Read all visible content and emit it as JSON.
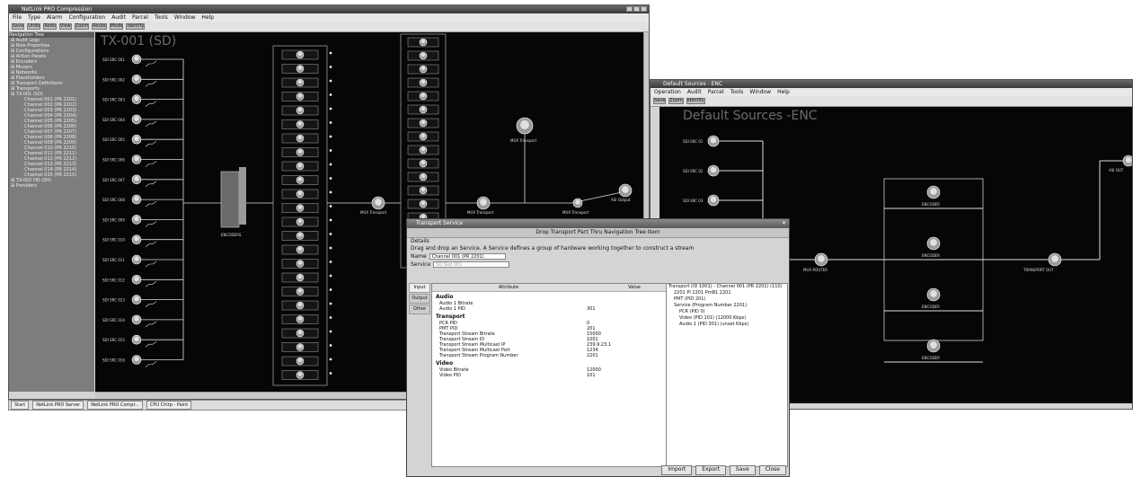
{
  "left_window": {
    "title": "NetLink PRO Compression",
    "menu": [
      "File",
      "Type",
      "Alarm",
      "Configuration",
      "Audit",
      "Parcel",
      "Tools",
      "Window",
      "Help"
    ],
    "toolbar": [
      "Save",
      "Undo",
      "Redo",
      "View",
      "Zoom",
      "Route",
      "Mode",
      "Identify"
    ],
    "canvas_title": "TX-001 (SD)",
    "nav": {
      "title": "Navigation Tree",
      "items": [
        "Audit Logs",
        "Role Properties",
        "Configurations",
        "Action Panels",
        "Encoders",
        "Muxers",
        "Networks",
        "Placeholders",
        "Transport Definitions",
        "Transports",
        "TX-001 (SD)"
      ],
      "channels": [
        "Channel 001 (PR 2201)",
        "Channel 002 (PR 2202)",
        "Channel 003 (PR 2203)",
        "Channel 004 (PR 2204)",
        "Channel 005 (PR 2205)",
        "Channel 006 (PR 2206)",
        "Channel 007 (PR 2207)",
        "Channel 008 (PR 2208)",
        "Channel 009 (PR 2209)",
        "Channel 010 (PR 2210)",
        "Channel 011 (PR 2211)",
        "Channel 012 (PR 2212)",
        "Channel 013 (PR 2213)",
        "Channel 014 (PR 2214)",
        "Channel 015 (PR 2215)"
      ],
      "footer_items": [
        "TX-002 HD (SH)",
        "Providers"
      ]
    },
    "sources": [
      "SDI SRC 001",
      "SDI SRC 002",
      "SDI SRC 003",
      "SDI SRC 004",
      "SDI SRC 005",
      "SDI SRC 006",
      "SDI SRC 007",
      "SDI SRC 008",
      "SDI SRC 009",
      "SDI SRC 010",
      "SDI SRC 011",
      "SDI SRC 012",
      "SDI SRC 013",
      "SDI SRC 014",
      "SDI SRC 015",
      "SDI SRC 016"
    ],
    "node_labels": {
      "encoder_rack": "ENCODERS",
      "mux": "MUX Transport",
      "mid_a": "MUX Transport",
      "mid_b": "MUX Transport",
      "right_a": "MUX Transport",
      "output": "ASI Output"
    }
  },
  "right_window": {
    "title": "Default Sources - ENC",
    "menu": [
      "Operation",
      "Audit",
      "Parcel",
      "Tools",
      "Window",
      "Help"
    ],
    "toolbar": [
      "Save",
      "Zoom",
      "Identify"
    ],
    "canvas_title": "Default Sources -ENC",
    "sources": [
      "SDI SRC 01",
      "SDI SRC 02",
      "SDI SRC 03"
    ],
    "nodes": [
      "ENCODER",
      "ENCODER",
      "ENCODER",
      "ENCODER"
    ],
    "mux_label": "MUX ROUTER",
    "out_label": "TRANSPORT OUT",
    "final_label": "ASI OUT"
  },
  "taskbar": {
    "start": "Start",
    "items": [
      "NetLink PRO Server",
      "NetLink PRO Compr...",
      "CPU Chirp - Paint"
    ]
  },
  "dialog": {
    "title": "Transport Service",
    "subtitle": "Drop Transport Part Thru Navigation Tree Item",
    "details_label": "Details",
    "description": "Drag and drop an Service. A Service defines a group of hardware working together to construct a stream",
    "name_label": "Name",
    "name_value": "Channel 001 (PR 2201)",
    "service_label": "Service",
    "service_value": "SD Slot 001",
    "tabs": [
      "Input",
      "Output",
      "Other"
    ],
    "table_headers": [
      "Attribute",
      "Value"
    ],
    "groups": [
      {
        "name": "Audio",
        "rows": [
          {
            "attr": "Audio 1 Bitrate",
            "value": ""
          },
          {
            "attr": "Audio 1 PID",
            "value": "301"
          }
        ]
      },
      {
        "name": "Transport",
        "rows": [
          {
            "attr": "PCR PID",
            "value": "0"
          },
          {
            "attr": "PMT PID",
            "value": "201"
          },
          {
            "attr": "Transport Stream Bitrate",
            "value": "15000"
          },
          {
            "attr": "Transport Stream ID",
            "value": "1001"
          },
          {
            "attr": "Transport Stream Multicast IP",
            "value": "239.9.23.1"
          },
          {
            "attr": "Transport Stream Multicast Port",
            "value": "1234"
          },
          {
            "attr": "Transport Stream Program Number",
            "value": "2201"
          }
        ]
      },
      {
        "name": "Video",
        "rows": [
          {
            "attr": "Video Bitrate",
            "value": "12000"
          },
          {
            "attr": "Video PID",
            "value": "101"
          }
        ]
      }
    ],
    "tree": [
      "Transport (ID 1001) - Channel 001 (PR 2201) (110)",
      "2201 PI 2201 PmB1 2201",
      "PMT (PID 201)",
      "Service (Program Number 2201)",
      "PCR (PID 0)",
      "Video (PID 101) (12000 Kbps)",
      "Audio 1 (PID 301) (unset Kbps)"
    ],
    "buttons": [
      "Import",
      "Export",
      "Save",
      "Close"
    ]
  }
}
